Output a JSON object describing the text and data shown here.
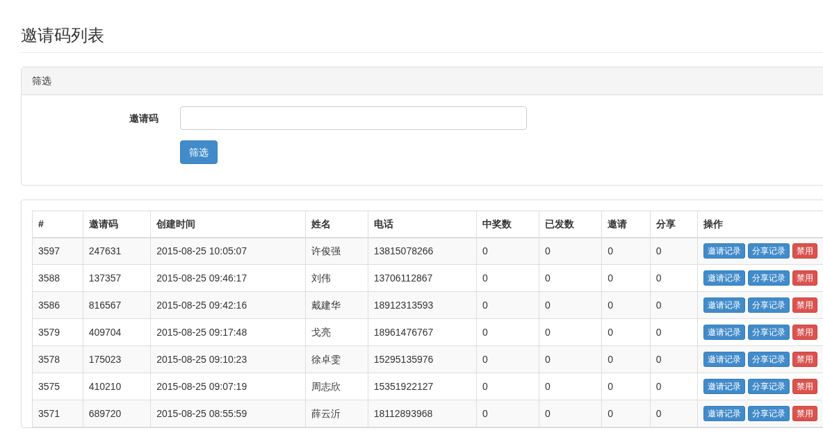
{
  "page_title": "邀请码列表",
  "filter_panel": {
    "title": "筛选",
    "field_label": "邀请码",
    "button": "筛选"
  },
  "table": {
    "columns": [
      "#",
      "邀请码",
      "创建时间",
      "姓名",
      "电话",
      "中奖数",
      "已发数",
      "邀请",
      "分享",
      "操作"
    ],
    "rows": [
      {
        "cells": [
          "3597",
          "247631",
          "2015-08-25 10:05:07",
          "许俊强",
          "13815078266",
          "0",
          "0",
          "0",
          "0"
        ],
        "actions": [
          {
            "label": "邀请记录",
            "kind": "primary"
          },
          {
            "label": "分享记录",
            "kind": "primary"
          },
          {
            "label": "禁用",
            "kind": "danger"
          }
        ]
      },
      {
        "cells": [
          "3588",
          "137357",
          "2015-08-25 09:46:17",
          "刘伟",
          "13706112867",
          "0",
          "0",
          "0",
          "0"
        ],
        "actions": [
          {
            "label": "邀请记录",
            "kind": "primary"
          },
          {
            "label": "分享记录",
            "kind": "primary"
          },
          {
            "label": "禁用",
            "kind": "danger"
          }
        ]
      },
      {
        "cells": [
          "3586",
          "816567",
          "2015-08-25 09:42:16",
          "戴建华",
          "18912313593",
          "0",
          "0",
          "0",
          "0"
        ],
        "actions": [
          {
            "label": "邀请记录",
            "kind": "primary"
          },
          {
            "label": "分享记录",
            "kind": "primary"
          },
          {
            "label": "禁用",
            "kind": "danger"
          }
        ]
      },
      {
        "cells": [
          "3579",
          "409704",
          "2015-08-25 09:17:48",
          "戈亮",
          "18961476767",
          "0",
          "0",
          "0",
          "0"
        ],
        "actions": [
          {
            "label": "邀请记录",
            "kind": "primary"
          },
          {
            "label": "分享记录",
            "kind": "primary"
          },
          {
            "label": "禁用",
            "kind": "danger"
          }
        ]
      },
      {
        "cells": [
          "3578",
          "175023",
          "2015-08-25 09:10:23",
          "徐卓雯",
          "15295135976",
          "0",
          "0",
          "0",
          "0"
        ],
        "actions": [
          {
            "label": "邀请记录",
            "kind": "primary"
          },
          {
            "label": "分享记录",
            "kind": "primary"
          },
          {
            "label": "禁用",
            "kind": "danger"
          }
        ]
      },
      {
        "cells": [
          "3575",
          "410210",
          "2015-08-25 09:07:19",
          "周志欣",
          "15351922127",
          "0",
          "0",
          "0",
          "0"
        ],
        "actions": [
          {
            "label": "邀请记录",
            "kind": "primary"
          },
          {
            "label": "分享记录",
            "kind": "primary"
          },
          {
            "label": "禁用",
            "kind": "danger"
          }
        ]
      },
      {
        "cells": [
          "3571",
          "689720",
          "2015-08-25 08:55:59",
          "薛云沂",
          "18112893968",
          "0",
          "0",
          "0",
          "0"
        ],
        "actions": [
          {
            "label": "邀请记录",
            "kind": "primary"
          },
          {
            "label": "分享记录",
            "kind": "primary"
          },
          {
            "label": "禁用",
            "kind": "danger"
          }
        ]
      }
    ]
  }
}
